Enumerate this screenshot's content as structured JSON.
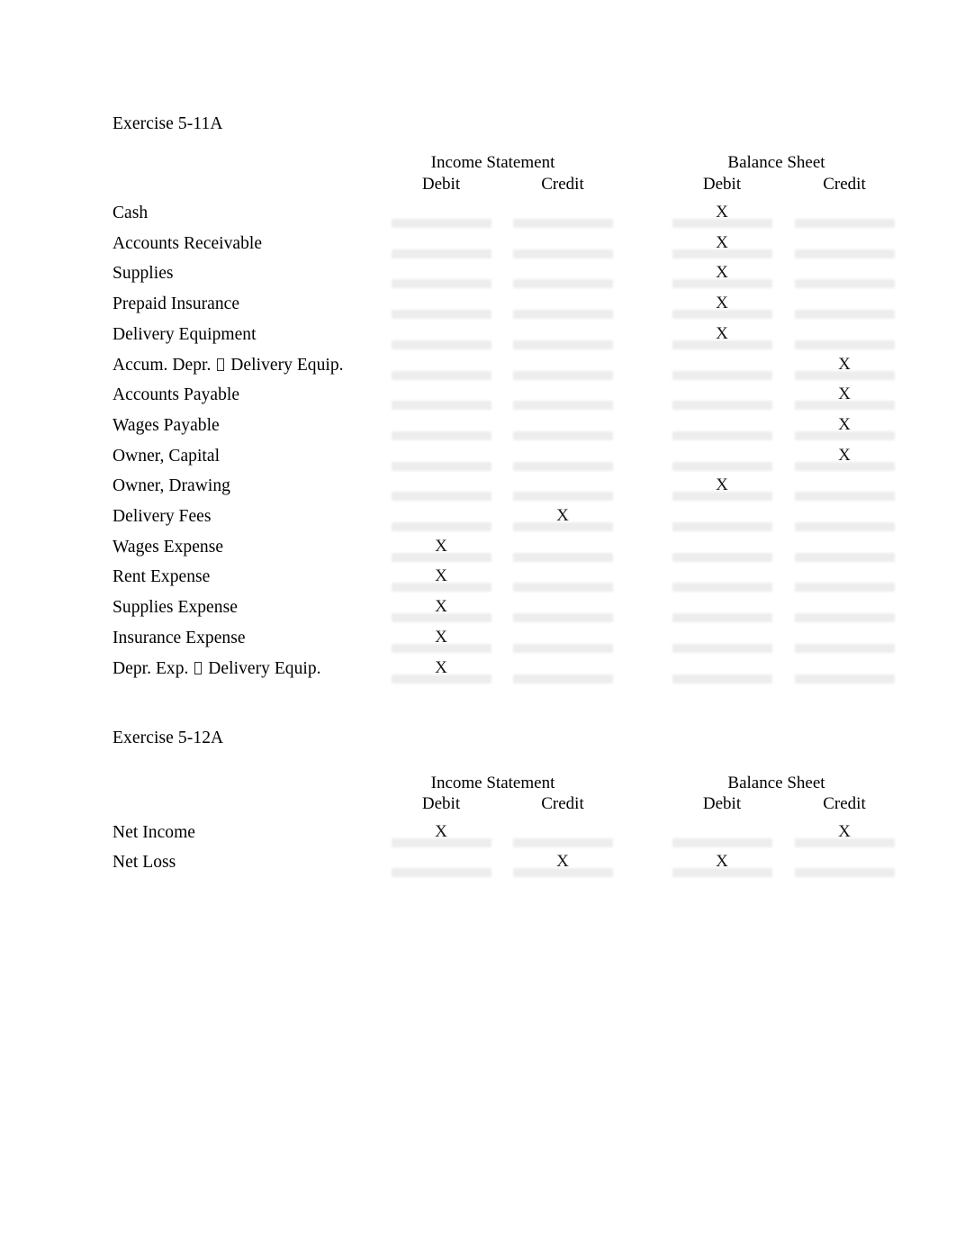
{
  "document": {
    "background_color": "#ffffff",
    "text_color": "#000000",
    "rule_color": "#ececec"
  },
  "exercises": [
    {
      "id": "ex-5-11a",
      "title": "Exercise 5-11A",
      "headers": {
        "income_statement": "Income Statement",
        "balance_sheet": "Balance Sheet",
        "columns": [
          "Debit",
          "Credit",
          "Debit",
          "Credit"
        ]
      },
      "mark_symbol": "X",
      "rows": [
        {
          "label": "Cash",
          "marks": [
            "",
            "",
            "X",
            ""
          ]
        },
        {
          "label": "Accounts Receivable",
          "marks": [
            "",
            "",
            "X",
            ""
          ]
        },
        {
          "label": "Supplies",
          "marks": [
            "",
            "",
            "X",
            ""
          ]
        },
        {
          "label": "Prepaid Insurance",
          "marks": [
            "",
            "",
            "X",
            ""
          ]
        },
        {
          "label": "Delivery Equipment",
          "marks": [
            "",
            "",
            "X",
            ""
          ]
        },
        {
          "label_pre": "Accum. Depr. ",
          "label_glyph": "missing-glyph-box",
          "label_post": " Delivery Equip.",
          "label": "Accum. Depr.  Delivery Equip.",
          "marks": [
            "",
            "",
            "",
            "X"
          ]
        },
        {
          "label": "Accounts Payable",
          "marks": [
            "",
            "",
            "",
            "X"
          ]
        },
        {
          "label": "Wages Payable",
          "marks": [
            "",
            "",
            "",
            "X"
          ]
        },
        {
          "label": "Owner, Capital",
          "marks": [
            "",
            "",
            "",
            "X"
          ]
        },
        {
          "label": "Owner, Drawing",
          "marks": [
            "",
            "",
            "X",
            ""
          ]
        },
        {
          "label": "Delivery Fees",
          "marks": [
            "",
            "X",
            "",
            ""
          ]
        },
        {
          "label": "Wages Expense",
          "marks": [
            "X",
            "",
            "",
            ""
          ]
        },
        {
          "label": "Rent Expense",
          "marks": [
            "X",
            "",
            "",
            ""
          ]
        },
        {
          "label": "Supplies Expense",
          "marks": [
            "X",
            "",
            "",
            ""
          ]
        },
        {
          "label": "Insurance Expense",
          "marks": [
            "X",
            "",
            "",
            ""
          ]
        },
        {
          "label_pre": "Depr. Exp. ",
          "label_glyph": "missing-glyph-box",
          "label_post": " Delivery Equip.",
          "label": "Depr. Exp.  Delivery Equip.",
          "marks": [
            "X",
            "",
            "",
            ""
          ]
        }
      ]
    },
    {
      "id": "ex-5-12a",
      "title": "Exercise 5-12A",
      "headers": {
        "income_statement": "Income Statement",
        "balance_sheet": "Balance Sheet",
        "columns": [
          "Debit",
          "Credit",
          "Debit",
          "Credit"
        ]
      },
      "mark_symbol": "X",
      "rows": [
        {
          "label": "Net Income",
          "marks": [
            "X",
            "",
            "",
            "X"
          ]
        },
        {
          "label": "Net Loss",
          "marks": [
            "",
            "X",
            "X",
            ""
          ]
        }
      ]
    }
  ]
}
